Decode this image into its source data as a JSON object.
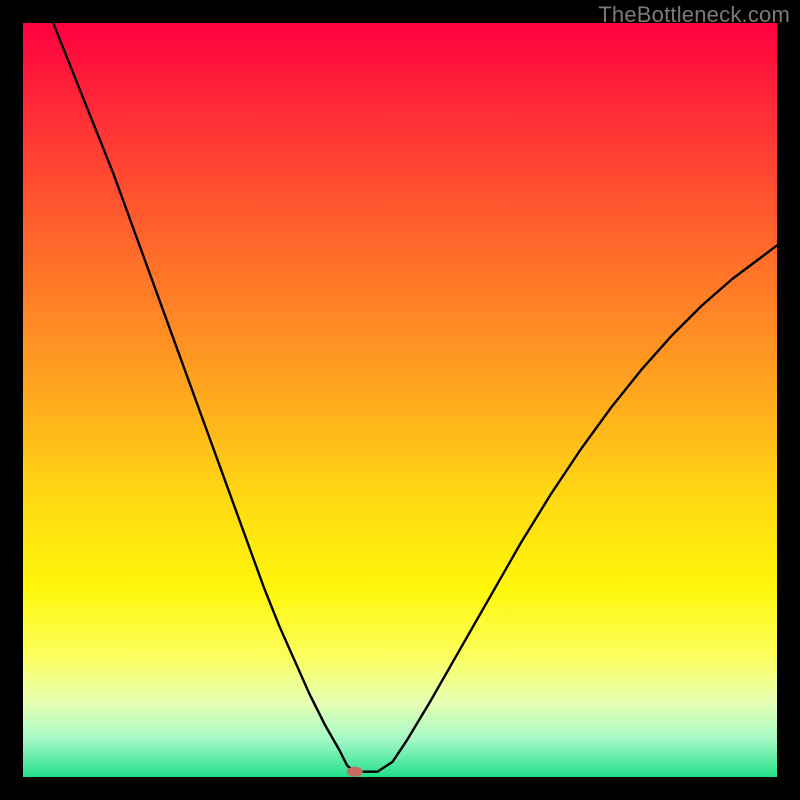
{
  "watermark": "TheBottleneck.com",
  "chart_data": {
    "type": "line",
    "title": "",
    "xlabel": "",
    "ylabel": "",
    "xlim": [
      0,
      100
    ],
    "ylim": [
      0,
      100
    ],
    "grid": false,
    "legend": false,
    "background_gradient": {
      "orientation": "vertical",
      "stops": [
        {
          "pos": 0.0,
          "color": "#ff0040"
        },
        {
          "pos": 0.12,
          "color": "#ff2d37"
        },
        {
          "pos": 0.3,
          "color": "#ff6a2a"
        },
        {
          "pos": 0.48,
          "color": "#ffa31f"
        },
        {
          "pos": 0.63,
          "color": "#ffd912"
        },
        {
          "pos": 0.75,
          "color": "#fff60a"
        },
        {
          "pos": 0.84,
          "color": "#fbff5e"
        },
        {
          "pos": 0.9,
          "color": "#e8ffb3"
        },
        {
          "pos": 0.95,
          "color": "#a5f9c7"
        },
        {
          "pos": 1.0,
          "color": "#22e08a"
        }
      ]
    },
    "series": [
      {
        "name": "curve",
        "x": [
          4,
          6,
          8,
          10,
          12,
          14,
          16,
          18,
          20,
          22,
          24,
          26,
          28,
          30,
          32,
          34,
          36,
          38,
          40,
          42,
          43,
          44,
          45,
          47,
          49,
          51,
          54,
          58,
          62,
          66,
          70,
          74,
          78,
          82,
          86,
          90,
          94,
          98,
          100
        ],
        "y": [
          100,
          95,
          90,
          85,
          80,
          74.5,
          69,
          63.5,
          58,
          52.5,
          47,
          41.5,
          36,
          30.5,
          25,
          20,
          15.5,
          11,
          7,
          3.5,
          1.5,
          0.7,
          0.7,
          0.7,
          2,
          5,
          10,
          17,
          24,
          31,
          37.5,
          43.5,
          49,
          54,
          58.5,
          62.5,
          66,
          69,
          70.5
        ]
      }
    ],
    "marker": {
      "x": 44,
      "y": 0.7,
      "color": "#c76a60",
      "rx": 8,
      "ry": 5
    }
  }
}
